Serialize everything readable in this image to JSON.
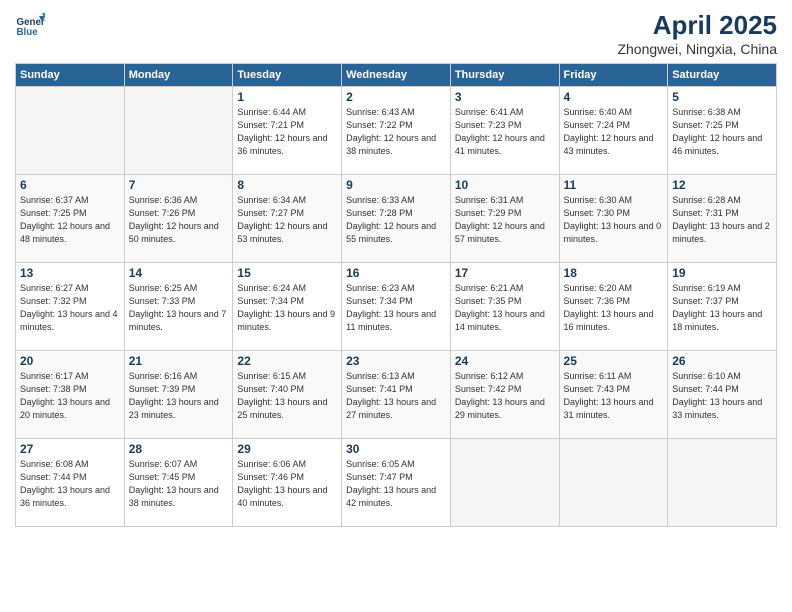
{
  "header": {
    "title": "April 2025",
    "subtitle": "Zhongwei, Ningxia, China"
  },
  "calendar": {
    "headers": [
      "Sunday",
      "Monday",
      "Tuesday",
      "Wednesday",
      "Thursday",
      "Friday",
      "Saturday"
    ],
    "weeks": [
      [
        {
          "day": "",
          "info": ""
        },
        {
          "day": "",
          "info": ""
        },
        {
          "day": "1",
          "info": "Sunrise: 6:44 AM\nSunset: 7:21 PM\nDaylight: 12 hours\nand 36 minutes."
        },
        {
          "day": "2",
          "info": "Sunrise: 6:43 AM\nSunset: 7:22 PM\nDaylight: 12 hours\nand 38 minutes."
        },
        {
          "day": "3",
          "info": "Sunrise: 6:41 AM\nSunset: 7:23 PM\nDaylight: 12 hours\nand 41 minutes."
        },
        {
          "day": "4",
          "info": "Sunrise: 6:40 AM\nSunset: 7:24 PM\nDaylight: 12 hours\nand 43 minutes."
        },
        {
          "day": "5",
          "info": "Sunrise: 6:38 AM\nSunset: 7:25 PM\nDaylight: 12 hours\nand 46 minutes."
        }
      ],
      [
        {
          "day": "6",
          "info": "Sunrise: 6:37 AM\nSunset: 7:25 PM\nDaylight: 12 hours\nand 48 minutes."
        },
        {
          "day": "7",
          "info": "Sunrise: 6:36 AM\nSunset: 7:26 PM\nDaylight: 12 hours\nand 50 minutes."
        },
        {
          "day": "8",
          "info": "Sunrise: 6:34 AM\nSunset: 7:27 PM\nDaylight: 12 hours\nand 53 minutes."
        },
        {
          "day": "9",
          "info": "Sunrise: 6:33 AM\nSunset: 7:28 PM\nDaylight: 12 hours\nand 55 minutes."
        },
        {
          "day": "10",
          "info": "Sunrise: 6:31 AM\nSunset: 7:29 PM\nDaylight: 12 hours\nand 57 minutes."
        },
        {
          "day": "11",
          "info": "Sunrise: 6:30 AM\nSunset: 7:30 PM\nDaylight: 13 hours\nand 0 minutes."
        },
        {
          "day": "12",
          "info": "Sunrise: 6:28 AM\nSunset: 7:31 PM\nDaylight: 13 hours\nand 2 minutes."
        }
      ],
      [
        {
          "day": "13",
          "info": "Sunrise: 6:27 AM\nSunset: 7:32 PM\nDaylight: 13 hours\nand 4 minutes."
        },
        {
          "day": "14",
          "info": "Sunrise: 6:25 AM\nSunset: 7:33 PM\nDaylight: 13 hours\nand 7 minutes."
        },
        {
          "day": "15",
          "info": "Sunrise: 6:24 AM\nSunset: 7:34 PM\nDaylight: 13 hours\nand 9 minutes."
        },
        {
          "day": "16",
          "info": "Sunrise: 6:23 AM\nSunset: 7:34 PM\nDaylight: 13 hours\nand 11 minutes."
        },
        {
          "day": "17",
          "info": "Sunrise: 6:21 AM\nSunset: 7:35 PM\nDaylight: 13 hours\nand 14 minutes."
        },
        {
          "day": "18",
          "info": "Sunrise: 6:20 AM\nSunset: 7:36 PM\nDaylight: 13 hours\nand 16 minutes."
        },
        {
          "day": "19",
          "info": "Sunrise: 6:19 AM\nSunset: 7:37 PM\nDaylight: 13 hours\nand 18 minutes."
        }
      ],
      [
        {
          "day": "20",
          "info": "Sunrise: 6:17 AM\nSunset: 7:38 PM\nDaylight: 13 hours\nand 20 minutes."
        },
        {
          "day": "21",
          "info": "Sunrise: 6:16 AM\nSunset: 7:39 PM\nDaylight: 13 hours\nand 23 minutes."
        },
        {
          "day": "22",
          "info": "Sunrise: 6:15 AM\nSunset: 7:40 PM\nDaylight: 13 hours\nand 25 minutes."
        },
        {
          "day": "23",
          "info": "Sunrise: 6:13 AM\nSunset: 7:41 PM\nDaylight: 13 hours\nand 27 minutes."
        },
        {
          "day": "24",
          "info": "Sunrise: 6:12 AM\nSunset: 7:42 PM\nDaylight: 13 hours\nand 29 minutes."
        },
        {
          "day": "25",
          "info": "Sunrise: 6:11 AM\nSunset: 7:43 PM\nDaylight: 13 hours\nand 31 minutes."
        },
        {
          "day": "26",
          "info": "Sunrise: 6:10 AM\nSunset: 7:44 PM\nDaylight: 13 hours\nand 33 minutes."
        }
      ],
      [
        {
          "day": "27",
          "info": "Sunrise: 6:08 AM\nSunset: 7:44 PM\nDaylight: 13 hours\nand 36 minutes."
        },
        {
          "day": "28",
          "info": "Sunrise: 6:07 AM\nSunset: 7:45 PM\nDaylight: 13 hours\nand 38 minutes."
        },
        {
          "day": "29",
          "info": "Sunrise: 6:06 AM\nSunset: 7:46 PM\nDaylight: 13 hours\nand 40 minutes."
        },
        {
          "day": "30",
          "info": "Sunrise: 6:05 AM\nSunset: 7:47 PM\nDaylight: 13 hours\nand 42 minutes."
        },
        {
          "day": "",
          "info": ""
        },
        {
          "day": "",
          "info": ""
        },
        {
          "day": "",
          "info": ""
        }
      ]
    ]
  }
}
